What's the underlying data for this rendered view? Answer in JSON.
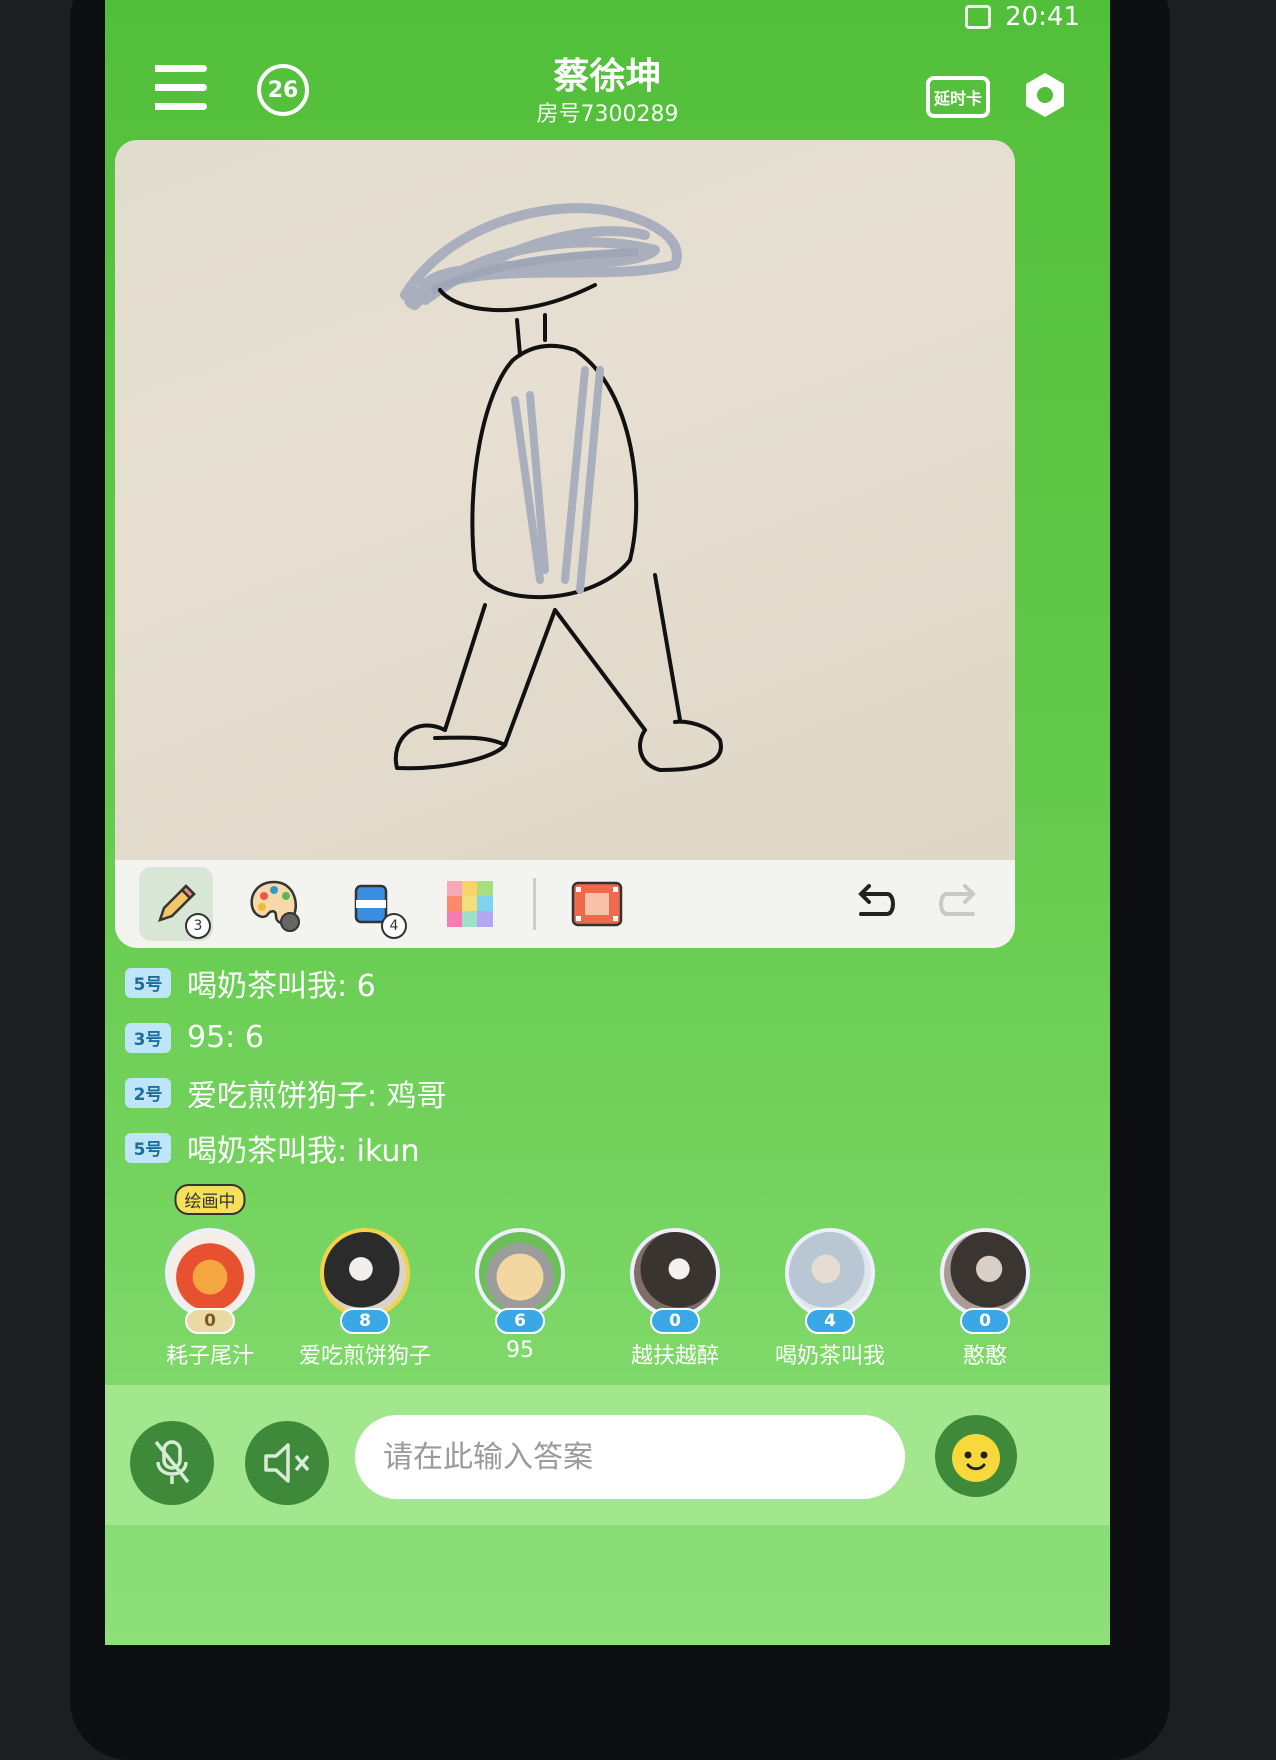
{
  "status_bar": {
    "time": "20:41"
  },
  "header": {
    "room_title": "蔡徐坤",
    "room_number": "房号7300289",
    "alarm_count": "26",
    "card_label": "延时卡"
  },
  "toolbar": {
    "pencil_count": "3",
    "eraser_count": "4"
  },
  "chat": [
    {
      "seat": "5号",
      "text": "喝奶茶叫我: 6"
    },
    {
      "seat": "3号",
      "text": "95: 6"
    },
    {
      "seat": "2号",
      "text": "爱吃煎饼狗子: 鸡哥"
    },
    {
      "seat": "5号",
      "text": "喝奶茶叫我: ikun"
    }
  ],
  "players": [
    {
      "name": "耗子尾汁",
      "score": "0",
      "badge": "绘画中"
    },
    {
      "name": "爱吃煎饼狗子",
      "score": "8"
    },
    {
      "name": "95",
      "score": "6"
    },
    {
      "name": "越扶越醉",
      "score": "0"
    },
    {
      "name": "喝奶茶叫我",
      "score": "4"
    },
    {
      "name": "憨憨",
      "score": "0"
    }
  ],
  "input": {
    "placeholder": "请在此输入答案"
  },
  "colors": {
    "screen_green": "#52bf3a",
    "score_badge": "#3aa7e6",
    "seat_tag": "#bfe6f8",
    "canvas": "#e2dccf"
  }
}
